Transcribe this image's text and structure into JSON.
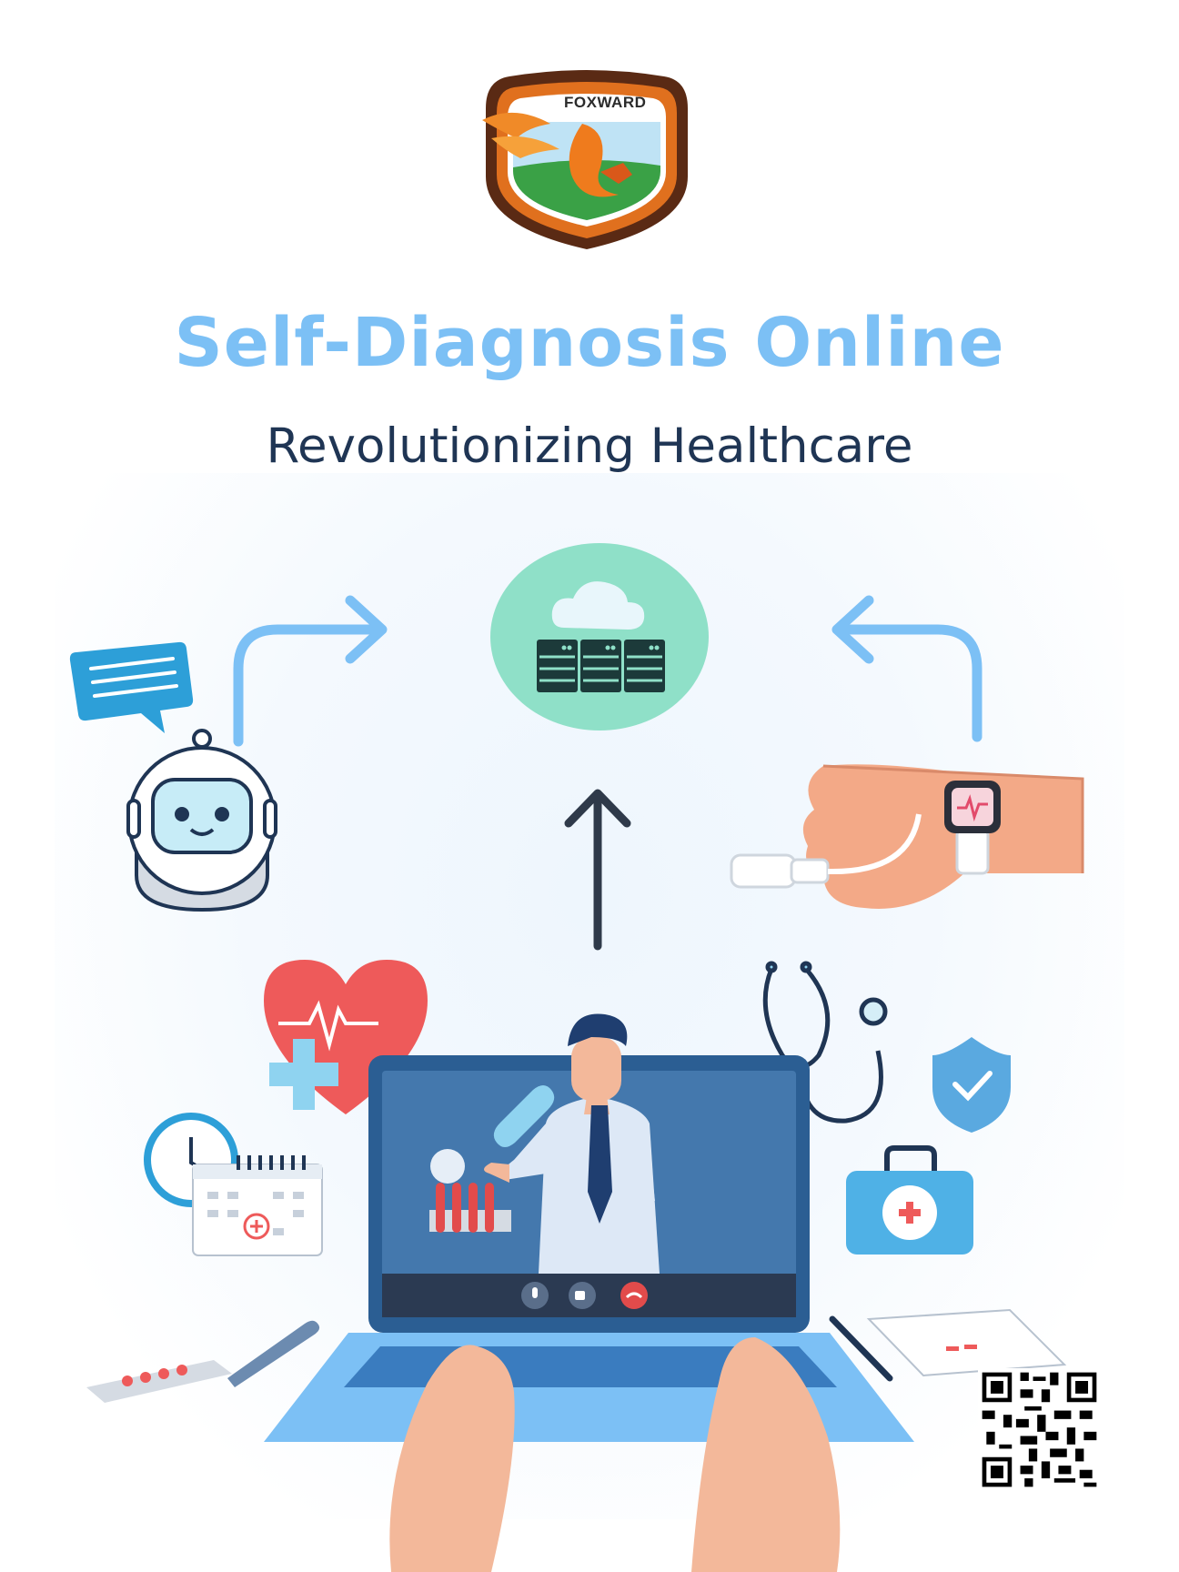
{
  "brand": {
    "logo_text": "FOXWARD"
  },
  "header": {
    "title": "Self-Diagnosis Online",
    "subtitle": "Revolutionizing Healthcare"
  },
  "icons": [
    "chat-bubble-icon",
    "robot-icon",
    "cloud-server-icon",
    "smartwatch-hand-icon",
    "heart-pulse-icon",
    "clock-icon",
    "calendar-icon",
    "stethoscope-icon",
    "shield-check-icon",
    "first-aid-kit-icon",
    "laptop-icon",
    "doctor-icon",
    "pill-icon",
    "test-tubes-icon",
    "microphone-icon",
    "video-icon",
    "phone-hangup-icon",
    "thermometer-icon",
    "pill-blister-icon",
    "pen-icon",
    "medical-clipboard-icon",
    "qr-code-icon"
  ],
  "colors": {
    "title": "#7cc0f5",
    "subtitle": "#1f3554",
    "arrow_light": "#7cc0f5",
    "arrow_dark": "#2f3a4a",
    "cloud_bg": "#8fe0c8",
    "heart": "#ee5a5a",
    "laptop_screen": "#2b5e93"
  }
}
